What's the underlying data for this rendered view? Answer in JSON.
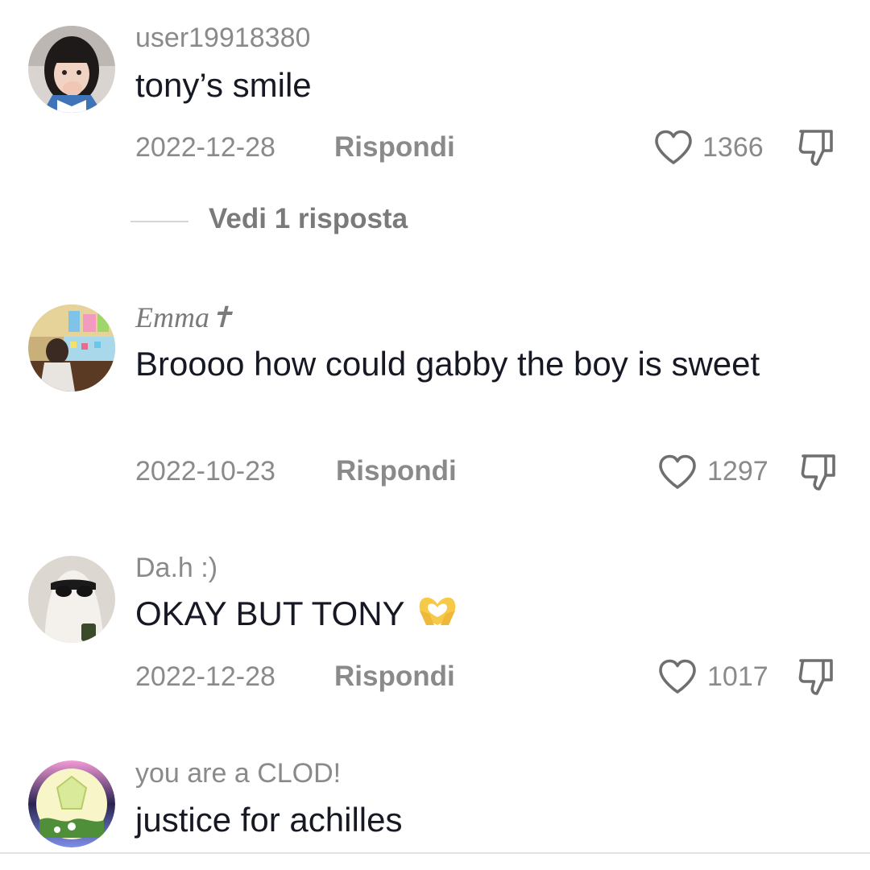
{
  "comments": [
    {
      "username": "user19918380",
      "text": "tony’s smile",
      "date": "2022-12-28",
      "reply_label": "Rispondi",
      "likes": "1366",
      "view_replies_label": "Vedi 1 risposta"
    },
    {
      "username": "Emma✝",
      "text": "Broooo how could gabby the boy is sweet",
      "date": "2022-10-23",
      "reply_label": "Rispondi",
      "likes": "1297"
    },
    {
      "username": "Da.h :)",
      "text": "OKAY BUT TONY",
      "emoji": "heart-hands-emoji",
      "date": "2022-12-28",
      "reply_label": "Rispondi",
      "likes": "1017"
    },
    {
      "username": "you are a CLOD!",
      "text": "justice for achilles"
    }
  ],
  "colors": {
    "text_primary": "#161823",
    "text_secondary": "#8a8a8a",
    "divider": "#e2e2e2",
    "emoji_yellow": "#f7c948"
  }
}
